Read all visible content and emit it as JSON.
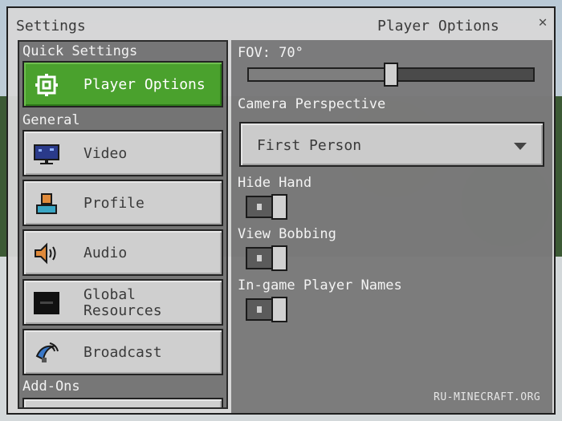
{
  "window": {
    "title": "Settings",
    "page_title": "Player Options",
    "close_label": "✕"
  },
  "sidebar": {
    "quick_settings_label": "Quick Settings",
    "general_label": "General",
    "addons_label": "Add-Ons",
    "items": [
      {
        "label": "Player Options",
        "icon": "gear-icon",
        "active": true
      },
      {
        "label": "Video",
        "icon": "monitor-icon",
        "active": false
      },
      {
        "label": "Profile",
        "icon": "profile-icon",
        "active": false
      },
      {
        "label": "Audio",
        "icon": "speaker-icon",
        "active": false
      },
      {
        "label": "Global Resources",
        "icon": "evo-icon",
        "active": false
      },
      {
        "label": "Broadcast",
        "icon": "satellite-dish-icon",
        "active": false
      }
    ]
  },
  "player_options": {
    "fov_label": "FOV: 70°",
    "fov_value": 70,
    "fov_level": 0.5,
    "camera_perspective_label": "Camera Perspective",
    "camera_perspective_value": "First Person",
    "hide_hand_label": "Hide Hand",
    "hide_hand_value": "on",
    "view_bobbing_label": "View Bobbing",
    "view_bobbing_value": "on",
    "ingame_player_names_label": "In-game Player Names",
    "ingame_player_names_value": "on"
  },
  "colors": {
    "active": "#4aa12d",
    "button": "#cfcfcf",
    "text": "#3a3a3a"
  },
  "watermark": "RU-MINECRAFT.ORG"
}
